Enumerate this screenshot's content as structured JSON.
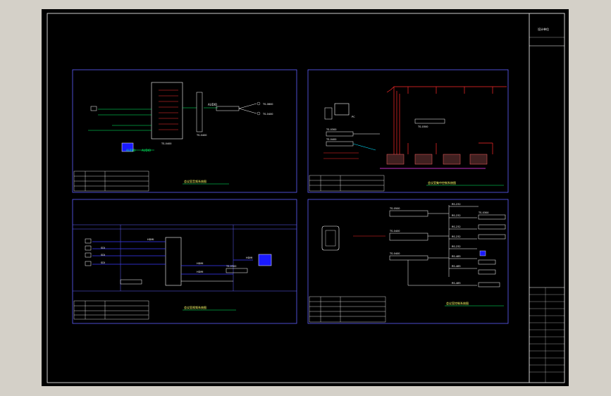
{
  "colors": {
    "frame": "#ffffff",
    "panel": "#6060ff",
    "signal_green": "#00ff66",
    "signal_blue": "#3a3aff",
    "signal_red": "#ff2a2a",
    "signal_magenta": "#ff40ff",
    "signal_cyan": "#00e0ff",
    "text": "#ffffff",
    "caption": "#ffff66"
  },
  "title_block": {
    "top_label": "设计单位"
  },
  "panel1": {
    "labels": {
      "audio1": "AUDIO",
      "audio2": "AUDIO",
      "audio3": "AUDIO",
      "product1": "TS-0400",
      "product2": "TS-0400",
      "product3": "TS-0800",
      "product4": "TS-0400"
    },
    "caption": "会议室音频系统图"
  },
  "panel2": {
    "labels": {
      "pc": "PC",
      "product1": "TS-0300",
      "product2": "TS-0400",
      "product3": "TS-0300"
    },
    "caption": "会议室集中控制系统图"
  },
  "panel3": {
    "labels": {
      "hdmi1": "HDMI",
      "hdmi2": "HDMI",
      "hdmi3": "HDMI",
      "hdmi4": "HDMI",
      "sdi1": "SDI",
      "sdi2": "SDI",
      "sdi3": "SDI",
      "product1": "TS-0300"
    },
    "caption": "会议室视频系统图"
  },
  "panel4": {
    "labels": {
      "ts1": "TS-0500",
      "ts2": "TS-0400",
      "ts3": "TS-0400",
      "ts4": "TS-0300",
      "rs1": "RS-232",
      "rs2": "RS-232",
      "rs3": "RS-232",
      "rs4": "RS-232",
      "rs5": "RS-232",
      "rs6": "RS-485",
      "rs7": "RS-485",
      "rs8": "RS-485"
    },
    "caption": "会议室控制系统图"
  }
}
